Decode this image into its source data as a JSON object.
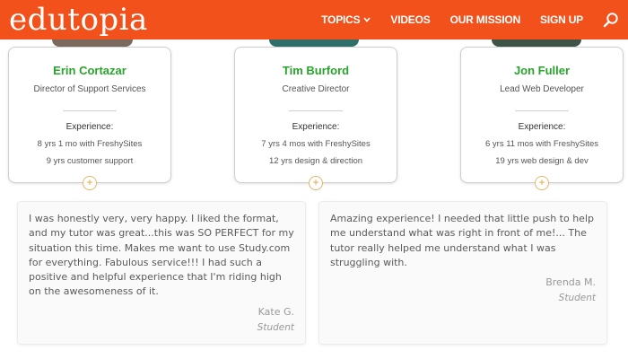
{
  "header": {
    "logo": "edutopia",
    "nav": [
      {
        "label": "TOPICS",
        "has_dropdown": true
      },
      {
        "label": "VIDEOS"
      },
      {
        "label": "OUR MISSION"
      },
      {
        "label": "SIGN UP"
      }
    ],
    "search_icon": "search-icon",
    "colors": {
      "brand": "#f2511b",
      "name_green": "#27a52b",
      "expand_orange": "#e3a13c"
    }
  },
  "profiles": [
    {
      "name": "Erin Cortazar",
      "role": "Director of Support Services",
      "experience_label": "Experience:",
      "experience": [
        "8 yrs 1 mo with FreshySites",
        "9 yrs customer support"
      ]
    },
    {
      "name": "Tim Burford",
      "role": "Creative Director",
      "experience_label": "Experience:",
      "experience": [
        "7 yrs 4 mos with FreshySites",
        "12 yrs design & direction"
      ]
    },
    {
      "name": "Jon Fuller",
      "role": "Lead Web Developer",
      "experience_label": "Experience:",
      "experience": [
        "6 yrs 11 mos with FreshySites",
        "19 yrs web design & dev"
      ]
    }
  ],
  "expand_symbol": "+",
  "testimonials": [
    {
      "lines": [
        "I was honestly very, very happy. I liked the format,",
        "and my tutor was great...this was SO PERFECT for my",
        "situation this time. Makes me want to use Study.com",
        "for everything. Fabulous service!!! I had such a",
        "positive and helpful experience that I'm riding high",
        "on the awesomeness of it."
      ],
      "author": "Kate G.",
      "author_role": "Student"
    },
    {
      "lines": [
        "Amazing experience! I needed that little push to help",
        "me understand what was right in front of me!... The",
        "tutor really helped me understand what I was",
        "struggling with."
      ],
      "author": "Brenda M.",
      "author_role": "Student"
    }
  ]
}
